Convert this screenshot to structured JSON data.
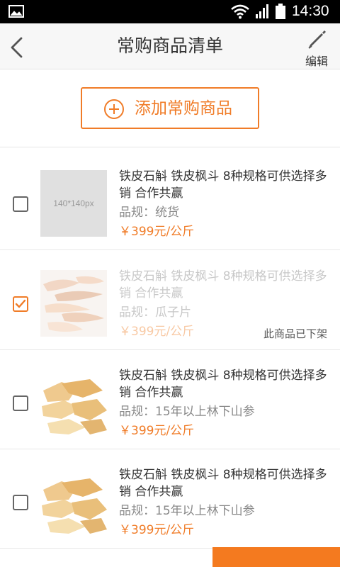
{
  "status_bar": {
    "time": "14:30"
  },
  "header": {
    "title": "常购商品清单",
    "edit_label": "编辑"
  },
  "add_button": {
    "label": "添加常购商品"
  },
  "products": [
    {
      "name": "铁皮石斛 铁皮枫斗  8种规格可供选择多销 合作共赢",
      "spec": "品规：统货",
      "price": "￥399元/公斤",
      "checked": false,
      "thumb_placeholder": "140*140px"
    },
    {
      "name": "铁皮石斛 铁皮枫斗  8种规格可供选择多销 合作共赢",
      "spec": "品规：瓜子片",
      "price": "￥399元/公斤",
      "checked": true,
      "off_shelf_text": "此商品已下架"
    },
    {
      "name": "铁皮石斛 铁皮枫斗  8种规格可供选择多销 合作共赢",
      "spec": "品规：15年以上林下山参",
      "price": "￥399元/公斤",
      "checked": false
    },
    {
      "name": "铁皮石斛 铁皮枫斗  8种规格可供选择多销 合作共赢",
      "spec": "品规：15年以上林下山参",
      "price": "￥399元/公斤",
      "checked": false
    }
  ],
  "colors": {
    "accent": "#f07c28",
    "header_bg": "#f7f7f7",
    "status_bg": "#000000"
  },
  "icons": [
    "gallery-icon",
    "wifi-icon",
    "signal-icon",
    "battery-icon",
    "back-arrow-icon",
    "pencil-icon",
    "plus-circle-icon",
    "checkmark-icon"
  ]
}
